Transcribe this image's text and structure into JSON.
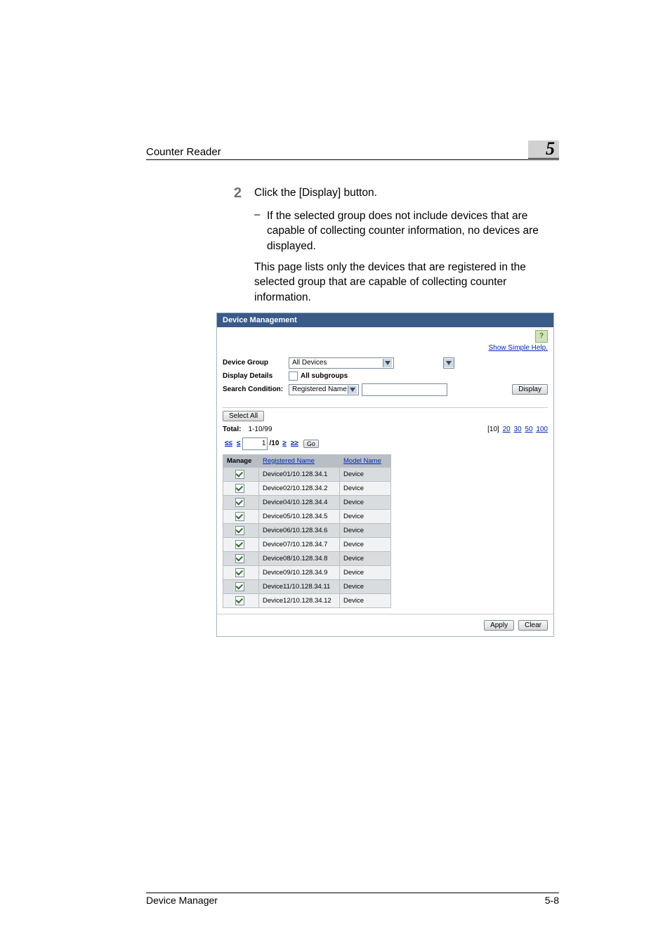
{
  "header": {
    "title": "Counter Reader",
    "chapter": "5"
  },
  "step": {
    "number": "2",
    "text": "Click the [Display] button.",
    "bullet": "If the selected group does not include devices that are capable of collecting counter information, no devices are displayed.",
    "note": "This page lists only the devices that are registered in the selected group that are capable of collecting counter information."
  },
  "shot": {
    "title": "Device Management",
    "help_link": "Show Simple Help.",
    "filters": {
      "group_label": "Device Group",
      "group_value": "All Devices",
      "details_label": "Display Details",
      "details_value": "All subgroups",
      "search_label": "Search Condition:",
      "search_field": "Registered Name",
      "display_btn": "Display"
    },
    "select_all": "Select All",
    "total_label": "Total:",
    "total_value": "1-10/99",
    "page_sizes": {
      "current": "[10]",
      "opts": [
        "20",
        "30",
        "50",
        "100"
      ]
    },
    "pager": {
      "first": "≤≤",
      "prev": "≤",
      "input": "1",
      "of": "/10",
      "next": "≥",
      "last": "≥≥",
      "go": "Go"
    },
    "columns": {
      "manage": "Manage",
      "name": "Registered Name",
      "model": "Model Name"
    },
    "rows": [
      {
        "name": "Device01/10.128.34.1",
        "model": "Device"
      },
      {
        "name": "Device02/10.128.34.2",
        "model": "Device"
      },
      {
        "name": "Device04/10.128.34.4",
        "model": "Device"
      },
      {
        "name": "Device05/10.128.34.5",
        "model": "Device"
      },
      {
        "name": "Device06/10.128.34.6",
        "model": "Device"
      },
      {
        "name": "Device07/10.128.34.7",
        "model": "Device"
      },
      {
        "name": "Device08/10.128.34.8",
        "model": "Device"
      },
      {
        "name": "Device09/10.128.34.9",
        "model": "Device"
      },
      {
        "name": "Device11/10.128.34.11",
        "model": "Device"
      },
      {
        "name": "Device12/10.128.34.12",
        "model": "Device"
      }
    ],
    "apply": "Apply",
    "clear": "Clear"
  },
  "footer": {
    "left": "Device Manager",
    "right": "5-8"
  }
}
